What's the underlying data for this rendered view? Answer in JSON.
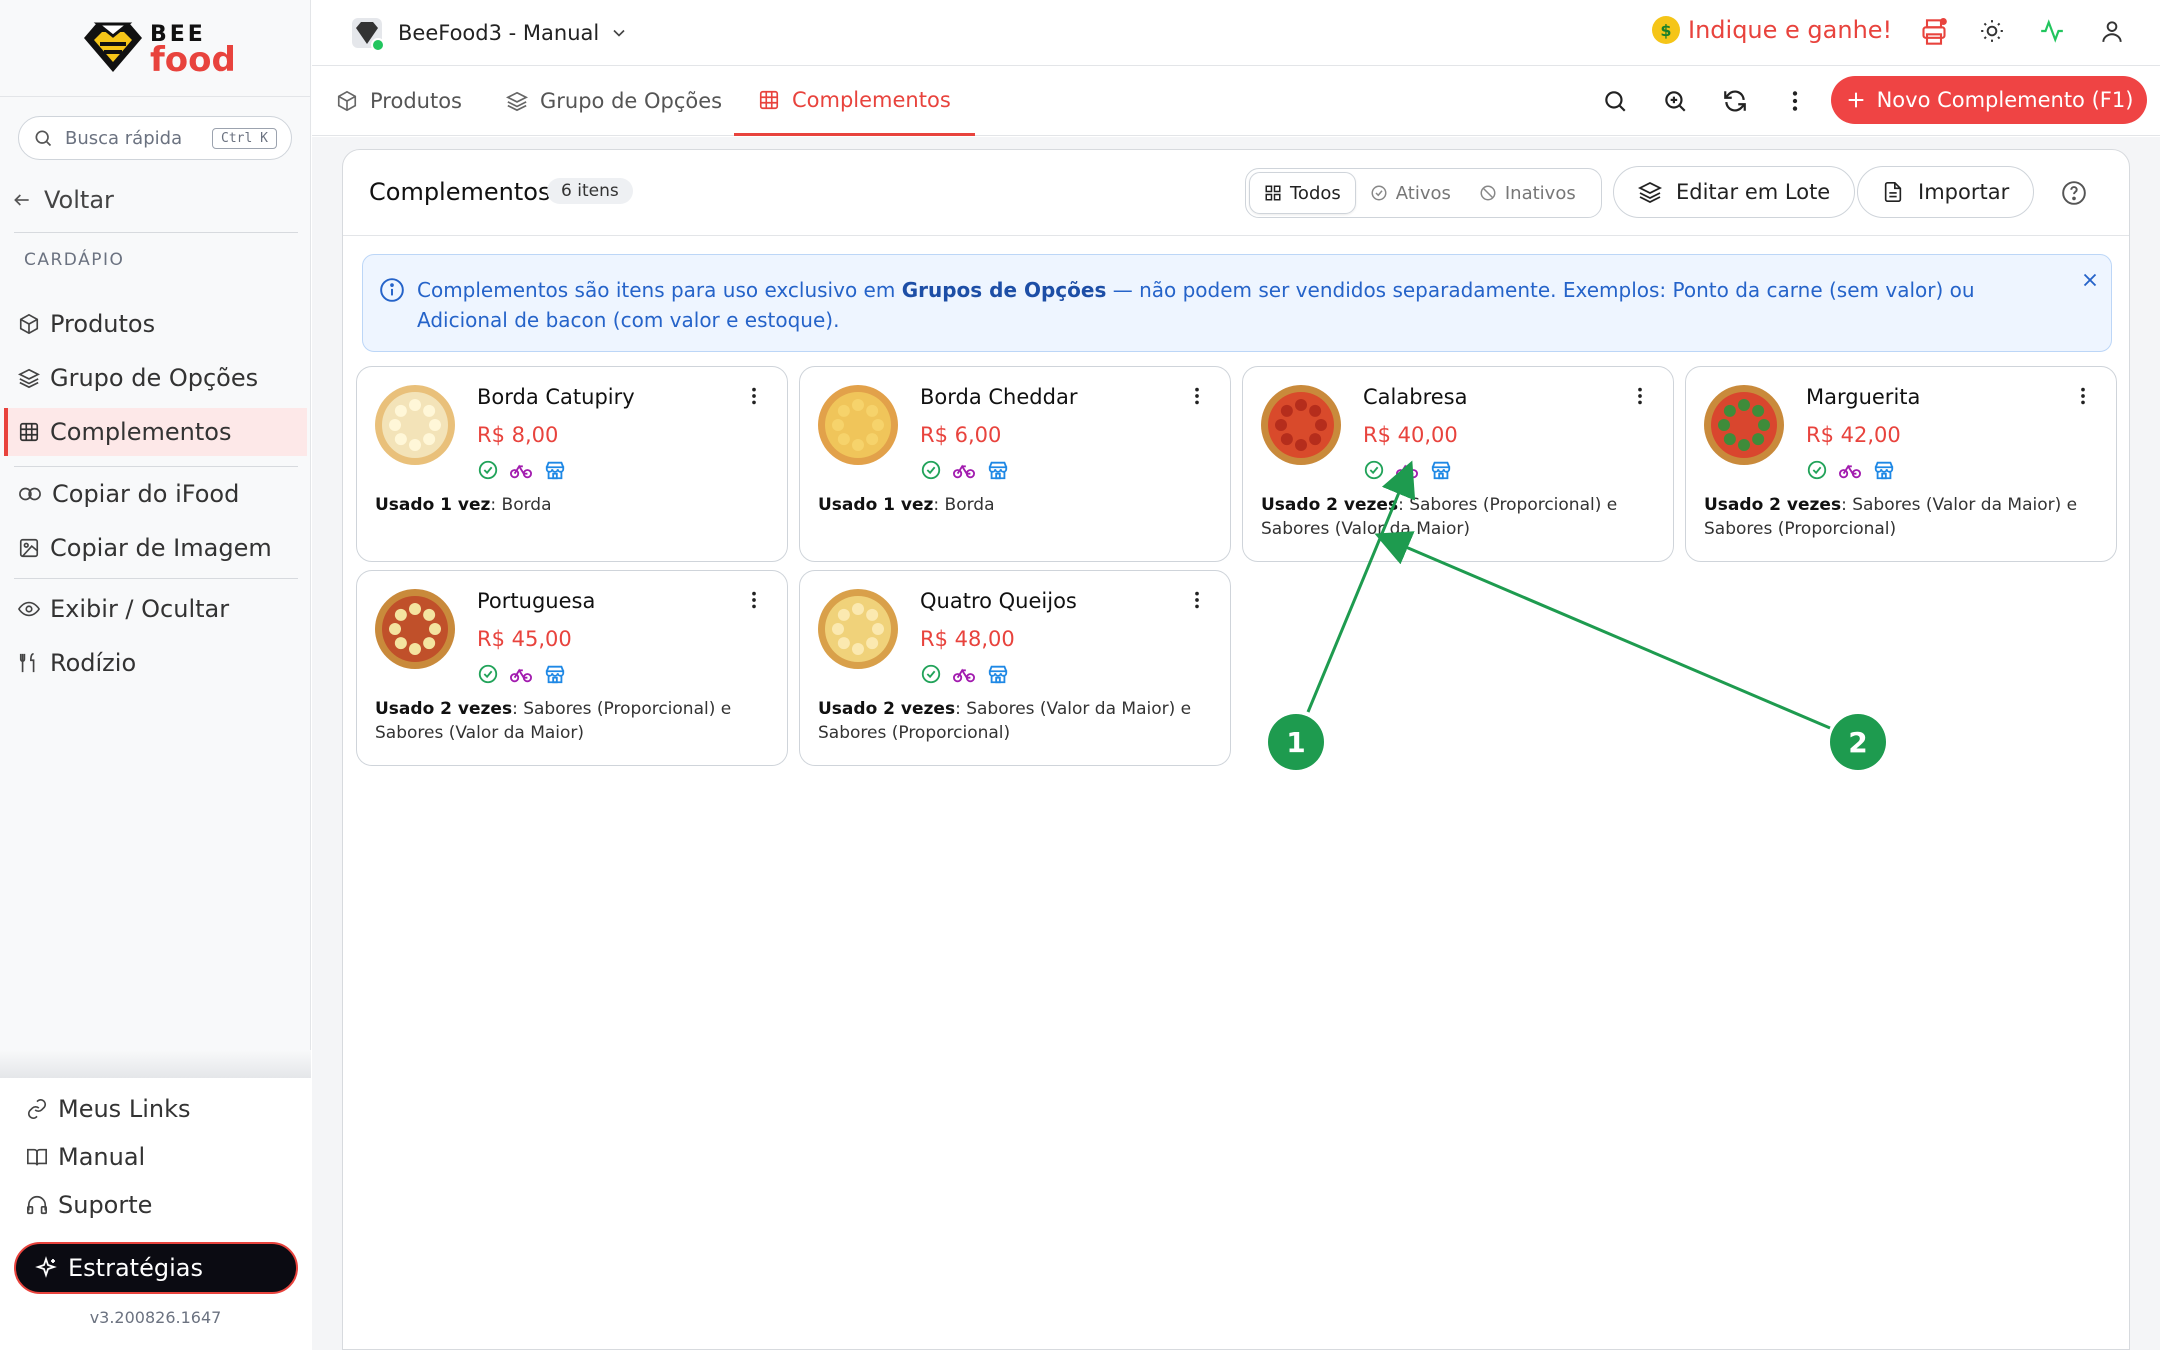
{
  "brand": {
    "bee": "BEE",
    "food": "food"
  },
  "sidebar": {
    "search_placeholder": "Busca rápida",
    "search_shortcut": "Ctrl K",
    "back_label": "Voltar",
    "section_label": "CARDÁPIO",
    "items": [
      {
        "label": "Produtos",
        "icon": "box-icon"
      },
      {
        "label": "Grupo de Opções",
        "icon": "layers-icon"
      },
      {
        "label": "Complementos",
        "icon": "grid-icon",
        "active": true
      },
      {
        "label": "Copiar do iFood",
        "icon": "copy-ifood-icon"
      },
      {
        "label": "Copiar de Imagem",
        "icon": "image-copy-icon"
      },
      {
        "label": "Exibir / Ocultar",
        "icon": "eye-icon"
      },
      {
        "label": "Rodízio",
        "icon": "fork-knife-icon"
      }
    ],
    "bottom_items": [
      {
        "label": "Meus Links",
        "icon": "link-icon"
      },
      {
        "label": "Manual",
        "icon": "book-icon"
      },
      {
        "label": "Suporte",
        "icon": "headset-icon"
      }
    ],
    "strategies_label": "Estratégias",
    "version": "v3.200826.1647"
  },
  "topbar": {
    "store_name": "BeeFood3 - Manual",
    "referral_label": "Indique e ganhe!"
  },
  "tabs": [
    {
      "label": "Produtos",
      "icon": "box-icon"
    },
    {
      "label": "Grupo de Opções",
      "icon": "layers-icon"
    },
    {
      "label": "Complementos",
      "icon": "grid-icon",
      "active": true
    }
  ],
  "toolbar": {
    "new_button_label": "Novo Complemento (F1)"
  },
  "panel": {
    "title": "Complementos",
    "count_label": "6 itens",
    "filters": [
      "Todos",
      "Ativos",
      "Inativos"
    ],
    "active_filter": "Todos",
    "bulk_edit_label": "Editar em Lote",
    "import_label": "Importar"
  },
  "info": {
    "text_1": "Complementos são itens para uso exclusivo em ",
    "text_bold": "Grupos de Opções",
    "text_2": " — não podem ser vendidos separadamente. Exemplos: Ponto da carne (sem valor) ou Adicional de bacon (com valor e estoque)."
  },
  "cards": [
    {
      "name": "Borda Catupiry",
      "price": "R$ 8,00",
      "usage_label": "Usado 1 vez",
      "usage_text": ": Borda"
    },
    {
      "name": "Borda Cheddar",
      "price": "R$ 6,00",
      "usage_label": "Usado 1 vez",
      "usage_text": ": Borda"
    },
    {
      "name": "Calabresa",
      "price": "R$ 40,00",
      "usage_label": "Usado 2 vezes",
      "usage_text": ": Sabores (Proporcional) e Sabores (Valor da Maior)"
    },
    {
      "name": "Marguerita",
      "price": "R$ 42,00",
      "usage_label": "Usado 2 vezes",
      "usage_text": ": Sabores (Valor da Maior) e Sabores (Proporcional)"
    },
    {
      "name": "Portuguesa",
      "price": "R$ 45,00",
      "usage_label": "Usado 2 vezes",
      "usage_text": ": Sabores (Proporcional) e Sabores (Valor da Maior)"
    },
    {
      "name": "Quatro Queijos",
      "price": "R$ 48,00",
      "usage_label": "Usado 2 vezes",
      "usage_text": ": Sabores (Valor da Maior) e Sabores (Proporcional)"
    }
  ],
  "annotations": {
    "marker_1": "1",
    "marker_2": "2"
  },
  "colors": {
    "brand_red": "#e8433d",
    "annotation_green": "#1e9b4f",
    "info_blue": "#2563c9"
  }
}
